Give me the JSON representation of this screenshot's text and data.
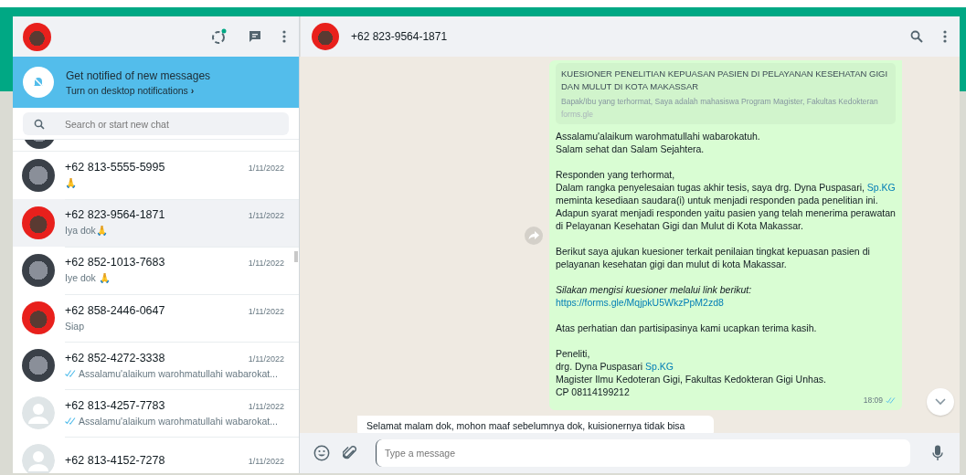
{
  "profile": {
    "kind": "photo"
  },
  "notification": {
    "title": "Get notified of new messages",
    "action": "Turn on desktop notifications",
    "chevron": "›"
  },
  "search": {
    "placeholder": "Search or start new chat"
  },
  "chats": [
    {
      "name": "+62 813-5555-5995",
      "date": "1/11/2022",
      "preview": "🙏",
      "kind": "photo",
      "read_ticks": false,
      "selected": false
    },
    {
      "name": "+62 823-9564-1871",
      "date": "1/11/2022",
      "preview": "Iya dok🙏",
      "kind": "photo",
      "read_ticks": false,
      "selected": true
    },
    {
      "name": "+62 852-1013-7683",
      "date": "1/11/2022",
      "preview": "Iye dok 🙏",
      "kind": "photo",
      "read_ticks": false,
      "selected": false
    },
    {
      "name": "+62 858-2446-0647",
      "date": "1/11/2022",
      "preview": "Siap",
      "kind": "photo",
      "read_ticks": false,
      "selected": false
    },
    {
      "name": "+62 852-4272-3338",
      "date": "1/11/2022",
      "preview": "Assalamu'alaikum warohmatullahi wabarokat...",
      "kind": "photo",
      "read_ticks": true,
      "selected": false
    },
    {
      "name": "+62 813-4257-7783",
      "date": "1/11/2022",
      "preview": "Assalamu'alaikum warohmatullahi wabarokat...",
      "kind": "default",
      "read_ticks": true,
      "selected": false
    },
    {
      "name": "+62 813-4152-7278",
      "date": "1/11/2022",
      "kind": "default",
      "selected": false
    }
  ],
  "conversation": {
    "title": "+62 823-9564-1871"
  },
  "message": {
    "preview": {
      "title": "KUESIONER PENELITIAN KEPUASAN PASIEN DI PELAYANAN KESEHATAN GIGI DAN MULUT DI KOTA MAKASSAR",
      "description": "Bapak/Ibu yang terhormat, Saya adalah mahasiswa Program Magister, Fakultas Kedokteran",
      "domain": "forms.gle"
    },
    "paragraphs": [
      [
        [
          {
            "kind": "text",
            "text": "Assalamu'alaikum warohmatullahi wabarokatuh."
          }
        ],
        [
          {
            "kind": "text",
            "text": "Salam sehat dan Salam Sejahtera."
          }
        ]
      ],
      [
        [
          {
            "kind": "text",
            "text": "Responden yang terhormat,"
          }
        ],
        [
          {
            "kind": "text",
            "text": "Dalam rangka penyelesaian tugas akhir tesis, saya drg. Dyna Puspasari, "
          },
          {
            "kind": "link",
            "text": "Sp.KG"
          }
        ],
        [
          {
            "kind": "text",
            "text": "meminta kesediaan saudara(i) untuk menjadi responden pada penelitian ini."
          }
        ],
        [
          {
            "kind": "text",
            "text": "Adapun syarat menjadi responden yaitu pasien yang telah menerima perawatan"
          }
        ],
        [
          {
            "kind": "text",
            "text": "di Pelayanan Kesehatan Gigi dan Mulut di Kota Makassar."
          }
        ]
      ],
      [
        [
          {
            "kind": "text",
            "text": "Berikut saya ajukan kuesioner terkait penilaian tingkat kepuasan pasien di"
          }
        ],
        [
          {
            "kind": "text",
            "text": "pelayanan kesehatan gigi dan mulut di kota Makassar."
          }
        ]
      ],
      [
        [
          {
            "kind": "italic",
            "text": "Silakan mengisi  kuesioner melalui link berikut:"
          }
        ],
        [
          {
            "kind": "link",
            "text": "https://forms.gle/MqjpkU5WkzPpM2zd8"
          }
        ]
      ],
      [
        [
          {
            "kind": "text",
            "text": "Atas perhatian dan partisipasinya kami ucapkan terima kasih."
          }
        ]
      ],
      [
        [
          {
            "kind": "text",
            "text": "Peneliti,"
          }
        ],
        [
          {
            "kind": "text",
            "text": "drg. Dyna Puspasari "
          },
          {
            "kind": "link",
            "text": "Sp.KG"
          }
        ],
        [
          {
            "kind": "text",
            "text": "Magister Ilmu Kedoteran Gigi, Fakultas Kedokteran Gigi Unhas."
          }
        ],
        [
          {
            "kind": "text",
            "text": "CP 08114199212"
          }
        ]
      ]
    ],
    "time": "18:09",
    "read_ticks": true
  },
  "incoming": {
    "text": "Selamat malam dok, mohon maaf sebelumnya dok, kuisionernya tidak bisa"
  },
  "composer": {
    "placeholder": "Type a message"
  }
}
